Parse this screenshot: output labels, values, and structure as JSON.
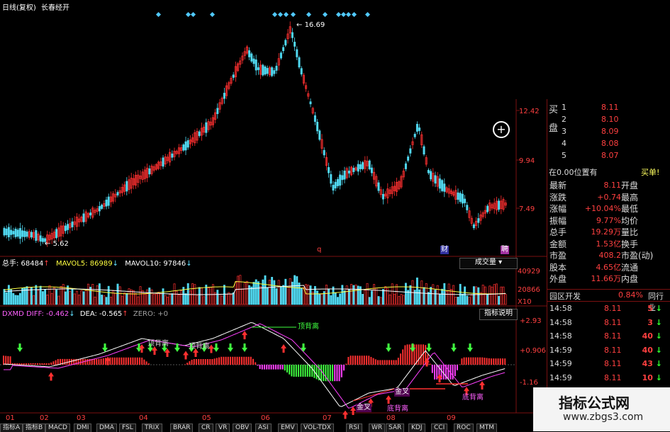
{
  "header": {
    "period": "日线(复权)",
    "indicator": "长春经开"
  },
  "price_chart": {
    "high_label": "16.69",
    "low_label": "5.62",
    "axis": [
      "12.42",
      "9.94",
      "7.49"
    ],
    "markers": [
      "q",
      "财",
      "聘"
    ]
  },
  "volume_panel": {
    "total_label": "总手: 68484",
    "mavol5_label": "MAVOL5: 86989",
    "mavol10_label": "MAVOL10: 97846",
    "button": "成交量",
    "axis": [
      "40929",
      "20866",
      "X10"
    ]
  },
  "macd_panel": {
    "title": "DXMD",
    "diff_label": "DIFF: -0.462",
    "dea_label": "DEA: -0.565",
    "zero_label": "ZERO: +0",
    "button": "指标说明",
    "axis": [
      "+2.93",
      "+0.906",
      "-1.16"
    ],
    "annotations": {
      "top_div_main": "顶背离",
      "top_div_a": "顶背离",
      "top_div_b": "顶背离",
      "golden_a": "金叉",
      "golden_b": "金叉",
      "bottom_div_a": "底背离",
      "bottom_div_b": "底背离"
    }
  },
  "x_axis": [
    "01",
    "02",
    "03",
    "04",
    "05",
    "06",
    "07",
    "08",
    "09"
  ],
  "bottom_tabs": [
    "指标A",
    "指标B",
    "MACD",
    "DMI",
    "DMA",
    "FSL",
    "TRIX",
    "BRAR",
    "CR",
    "VR",
    "OBV",
    "ASI",
    "EMV",
    "VOL-TDX",
    "RSI",
    "WR",
    "SAR",
    "KDJ",
    "CCI",
    "ROC",
    "MTM"
  ],
  "order_book": {
    "side_label_buy": "买",
    "side_label_pan": "盘",
    "levels": [
      {
        "n": "1",
        "price": "8.11",
        "vol": ""
      },
      {
        "n": "2",
        "price": "8.10",
        "vol": ""
      },
      {
        "n": "3",
        "price": "8.09",
        "vol": ""
      },
      {
        "n": "4",
        "price": "8.08",
        "vol": ""
      },
      {
        "n": "5",
        "price": "8.07",
        "vol": ""
      }
    ],
    "position_text": "在0.00位置有",
    "buy_single": "买单!"
  },
  "stats": [
    {
      "label": "最新",
      "value": "8.11",
      "label2": "开盘"
    },
    {
      "label": "涨跌",
      "value": "+0.74",
      "label2": "最高"
    },
    {
      "label": "涨幅",
      "value": "+10.04%",
      "label2": "最低"
    },
    {
      "label": "振幅",
      "value": "9.77%",
      "label2": "均价"
    },
    {
      "label": "总手",
      "value": "19.29万",
      "label2": "量比"
    },
    {
      "label": "金额",
      "value": "1.53亿",
      "label2": "换手"
    },
    {
      "label": "市盈",
      "value": "408.2",
      "label2": "市盈(动)"
    },
    {
      "label": "股本",
      "value": "4.65亿",
      "label2": "流通"
    },
    {
      "label": "外盘",
      "value": "11.66万",
      "label2": "内盘"
    }
  ],
  "sector": {
    "name": "园区开发",
    "change": "0.84%",
    "tab": "同行业"
  },
  "ticks": [
    {
      "time": "14:58",
      "price": "8.11",
      "vol": "5"
    },
    {
      "time": "14:58",
      "price": "8.11",
      "vol": "3"
    },
    {
      "time": "14:58",
      "price": "8.11",
      "vol": "40"
    },
    {
      "time": "14:59",
      "price": "8.11",
      "vol": "40"
    },
    {
      "time": "14:59",
      "price": "8.11",
      "vol": "43"
    },
    {
      "time": "14:59",
      "price": "8.11",
      "vol": "10"
    }
  ],
  "watermark": {
    "title": "指标公式网",
    "url": "www.zbgs3.com"
  },
  "colors": {
    "up": "#ff3030",
    "down": "#50d8f0",
    "bg": "#000000",
    "grid": "#7a1010"
  }
}
